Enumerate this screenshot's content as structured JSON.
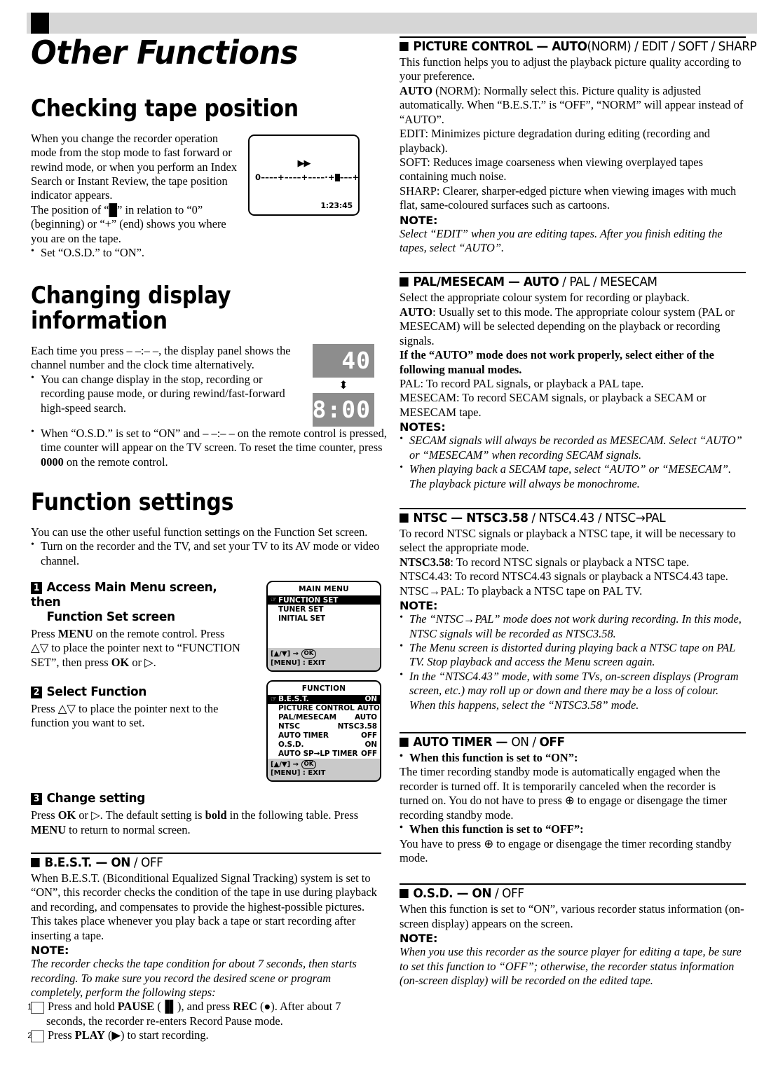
{
  "page": {
    "chapter_title": "Other Functions"
  },
  "left": {
    "checking_tape": {
      "heading": "Checking tape position",
      "para1": "When you change the recorder operation mode from the stop mode to fast forward or rewind mode, or when you perform an Index Search or Instant Review, the tape position indicator appears.",
      "para2": "The position of “█” in relation to “0” (beginning) or “+” (end) shows you where you are on the tape.",
      "bullet1": "Set “O.S.D.” to “ON”.",
      "tv_figure": {
        "ff_icon": "▶▶",
        "scale_left": "0––––+––––+––––·+",
        "scale_right": "–––+",
        "time": "1:23:45"
      }
    },
    "changing_display": {
      "heading": "Changing display information",
      "para1": "Each time you press – –:– –, the display panel shows the channel number and the clock time alternatively.",
      "bullet1": "You can change display in the stop, recording or recording pause mode, or during rewind/fast-forward high-speed search.",
      "bullet2_a": "When “O.S.D.” is set to “ON” and – –:– – on the remote control is pressed, time counter will appear on the TV screen. To reset the time counter, press ",
      "bullet2_bold": "0000",
      "bullet2_b": " on the remote control.",
      "lcd_channel": "40",
      "lcd_arrow": "⬍",
      "lcd_time": "8:00"
    },
    "function_settings": {
      "heading": "Function settings",
      "para1": "You can use the other useful function settings on the Function Set screen.",
      "bullet1": "Turn on the recorder and the TV, and set your TV to its AV mode or video channel.",
      "step1": {
        "num": "1",
        "title_line1": "Access Main Menu screen, then",
        "title_line2": "Function Set screen",
        "body_a": "Press ",
        "body_menu": "MENU",
        "body_b": " on the remote control. Press △▽ to place the pointer next to “FUNCTION SET”, then press ",
        "body_ok": "OK",
        "body_c": " or ▷."
      },
      "step2": {
        "num": "2",
        "title": "Select Function",
        "body": "Press △▽ to place the pointer next to the function you want to set."
      },
      "step3": {
        "num": "3",
        "title": "Change setting",
        "body_a": "Press ",
        "body_ok": "OK",
        "body_b": " or ▷. The default setting is ",
        "body_bold": "bold",
        "body_c": " in the following table. Press ",
        "body_menu": "MENU",
        "body_d": " to return to normal screen."
      }
    },
    "best": {
      "head_sq": "B.E.S.T. — ",
      "head_bold": "ON",
      "head_thin": " / OFF",
      "para1": "When B.E.S.T. (Biconditional Equalized Signal Tracking) system is set to “ON”, this recorder checks the condition of the tape in use during playback and recording, and compensates to provide the highest-possible pictures. This takes place whenever you play back a tape or start recording after inserting a tape.",
      "note_label": "NOTE:",
      "note_text": "The recorder checks the tape condition for about 7 seconds, then starts recording. To make sure you record the desired scene or program completely, perform the following steps:",
      "substep1_num": "1",
      "substep1_a": "Press and hold ",
      "substep1_pause": "PAUSE",
      "substep1_b": " (▐▌), and press ",
      "substep1_rec": "REC",
      "substep1_c": " (●). After about 7 seconds, the recorder re-enters Record Pause mode.",
      "substep2_num": "2",
      "substep2_a": "Press ",
      "substep2_play": "PLAY",
      "substep2_b": " (▶) to start recording."
    },
    "osd_main_menu": {
      "title": "MAIN MENU",
      "items": [
        {
          "pointer": "☞",
          "label": "FUNCTION SET",
          "value": "",
          "highlight": true
        },
        {
          "pointer": "",
          "label": "TUNER SET",
          "value": "",
          "highlight": false
        },
        {
          "pointer": "",
          "label": "INITIAL SET",
          "value": "",
          "highlight": false
        }
      ],
      "foot_line1_a": "[▲/▼] → ",
      "foot_ok": "OK",
      "foot_line2": "[MENU] : EXIT"
    },
    "osd_function": {
      "title": "FUNCTION",
      "items": [
        {
          "pointer": "☞",
          "label": "B.E.S.T.",
          "value": "ON",
          "highlight": true
        },
        {
          "pointer": "",
          "label": "PICTURE CONTROL",
          "value": "AUTO",
          "highlight": false
        },
        {
          "pointer": "",
          "label": "PAL/MESECAM",
          "value": "AUTO",
          "highlight": false
        },
        {
          "pointer": "",
          "label": "NTSC",
          "value": "NTSC3.58",
          "highlight": false
        },
        {
          "pointer": "",
          "label": "AUTO TIMER",
          "value": "OFF",
          "highlight": false
        },
        {
          "pointer": "",
          "label": "O.S.D.",
          "value": "ON",
          "highlight": false
        },
        {
          "pointer": "",
          "label": "AUTO SP→LP TIMER",
          "value": "OFF",
          "highlight": false
        }
      ],
      "foot_line1_a": "[▲/▼] → ",
      "foot_ok": "OK",
      "foot_line2": "[MENU] : EXIT"
    }
  },
  "right": {
    "picture_control": {
      "head_bold": "PICTURE CONTROL — AUTO",
      "head_thin": "(NORM) / EDIT / SOFT / SHARP",
      "para1": "This function helps you to adjust the playback picture quality according to your preference.",
      "auto_label": "AUTO",
      "auto_text": " (NORM): Normally select this. Picture quality is adjusted automatically. When “B.E.S.T.” is “OFF”, “NORM” will appear instead of “AUTO”.",
      "edit_text": "EDIT: Minimizes picture degradation during editing (recording and playback).",
      "soft_text": "SOFT: Reduces image coarseness when viewing overplayed tapes containing much noise.",
      "sharp_text": "SHARP: Clearer, sharper-edged picture when viewing images with much flat, same-coloured surfaces such as cartoons.",
      "note_label": "NOTE:",
      "note_text": "Select “EDIT” when you are editing tapes. After you finish editing the tapes, select “AUTO”."
    },
    "pal_mesecam": {
      "head_bold": "PAL/MESECAM — AUTO",
      "head_thin": " / PAL / MESECAM",
      "para1": "Select the appropriate colour system for recording or playback.",
      "auto_label": "AUTO",
      "auto_text": ": Usually set to this mode. The appropriate colour system (PAL or MESECAM) will be selected depending on the playback or recording signals.",
      "bold_para": "If the “AUTO” mode does not work properly, select either of the following manual modes.",
      "pal_text": "PAL: To record PAL signals, or playback a PAL tape.",
      "mesecam_text": "MESECAM: To record SECAM signals, or playback a SECAM or MESECAM tape.",
      "notes_label": "NOTES:",
      "note1": "SECAM signals will always be recorded as MESECAM. Select “AUTO” or “MESECAM” when recording SECAM signals.",
      "note2": "When playing back a SECAM tape, select “AUTO” or “MESECAM”. The playback picture will always be monochrome."
    },
    "ntsc": {
      "head_bold": "NTSC — NTSC3.58",
      "head_thin": " / NTSC4.43 / NTSC→PAL",
      "para1": "To record NTSC signals or playback a NTSC tape, it will be necessary to select the appropriate mode.",
      "n358_label": "NTSC3.58",
      "n358_text": ": To record NTSC signals or playback a NTSC tape.",
      "n443_text": "NTSC4.43: To record NTSC4.43 signals or playback a NTSC4.43 tape.",
      "npal_text": "NTSC→PAL: To playback a NTSC tape on PAL TV.",
      "note_label": "NOTE:",
      "note1": "The “NTSC→PAL” mode does not work during recording. In this mode, NTSC signals will be recorded as NTSC3.58.",
      "note2": "The Menu screen is distorted during playing back a NTSC tape on PAL TV. Stop playback and access the Menu screen again.",
      "note3": "In the “NTSC4.43” mode, with some TVs, on-screen displays (Program screen, etc.) may roll up or down and there may be a loss of colour. When this happens, select the “NTSC3.58” mode."
    },
    "auto_timer": {
      "head_bold": "AUTO TIMER — ",
      "head_thin": "ON / ",
      "head_bold2": "OFF",
      "on_label": "When this function is set to “ON”:",
      "on_text": "The timer recording standby mode is automatically engaged when the recorder is turned off. It is temporarily canceled when the recorder is turned on. You do not have to press ⊕ to engage or disengage the timer recording standby mode.",
      "off_label": "When this function is set to “OFF”:",
      "off_text": "You have to press ⊕ to engage or disengage the timer recording standby mode."
    },
    "osd_section": {
      "head_bold": "O.S.D. — ON",
      "head_thin": " / OFF",
      "para1": "When this function is set to “ON”, various recorder status information (on-screen display) appears on the screen.",
      "note_label": "NOTE:",
      "note_text": "When you use this recorder as the source player for editing a tape, be sure to set this function to “OFF”; otherwise, the recorder status information (on-screen display) will be recorded on the edited tape."
    }
  }
}
